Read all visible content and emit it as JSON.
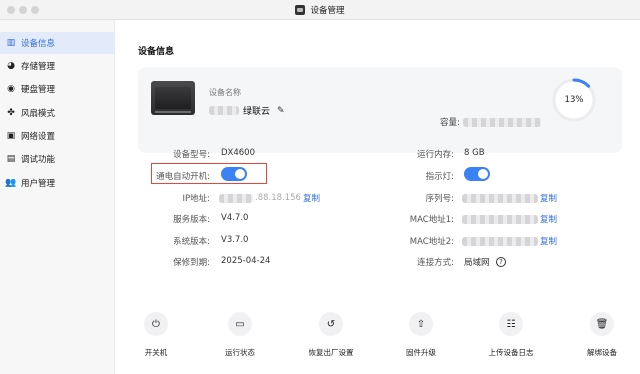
{
  "window": {
    "title": "设备管理"
  },
  "sidebar": {
    "items": [
      {
        "label": "设备信息",
        "icon": "device-info-icon",
        "active": true
      },
      {
        "label": "存储管理",
        "icon": "storage-icon",
        "active": false
      },
      {
        "label": "硬盘管理",
        "icon": "disk-icon",
        "active": false
      },
      {
        "label": "风扇模式",
        "icon": "fan-icon",
        "active": false
      },
      {
        "label": "网络设置",
        "icon": "network-icon",
        "active": false
      },
      {
        "label": "调试功能",
        "icon": "debug-icon",
        "active": false
      },
      {
        "label": "用户管理",
        "icon": "users-icon",
        "active": false
      }
    ]
  },
  "main": {
    "section_title": "设备信息",
    "device": {
      "name_label": "设备名称",
      "name_value": "绿联云",
      "capacity_label": "容量:",
      "capacity_percent": 13,
      "capacity_text": "13%"
    },
    "info_left": {
      "model_label": "设备型号:",
      "model_value": "DX4600",
      "power_on_label": "通电自动开机:",
      "power_on_enabled": true,
      "ip_label": "IP地址:",
      "ip_value_visible": ".88.18.156",
      "copy_label": "复制",
      "service_version_label": "服务版本:",
      "service_version_value": "V4.7.0",
      "system_version_label": "系统版本:",
      "system_version_value": "V3.7.0",
      "warranty_label": "保修到期:",
      "warranty_value": "2025-04-24"
    },
    "info_right": {
      "memory_label": "运行内存:",
      "memory_value": "8 GB",
      "indicator_label": "指示灯:",
      "indicator_enabled": true,
      "serial_label": "序列号:",
      "serial_copy_label": "复制",
      "mac1_label": "MAC地址1:",
      "mac1_copy_label": "复制",
      "mac2_label": "MAC地址2:",
      "mac2_copy_label": "复制",
      "connection_label": "连接方式:",
      "connection_value": "局域网"
    },
    "actions": [
      {
        "label": "开关机",
        "icon": "power-icon"
      },
      {
        "label": "运行状态",
        "icon": "monitor-icon"
      },
      {
        "label": "恢复出厂设置",
        "icon": "restore-icon"
      },
      {
        "label": "固件升级",
        "icon": "upgrade-icon"
      },
      {
        "label": "上传设备日志",
        "icon": "log-icon"
      },
      {
        "label": "解绑设备",
        "icon": "trash-icon"
      }
    ]
  },
  "colors": {
    "accent": "#2f6be0",
    "toggle_on": "#3b82f6",
    "highlight_box": "#e2483d",
    "ring_track": "#ececee"
  }
}
